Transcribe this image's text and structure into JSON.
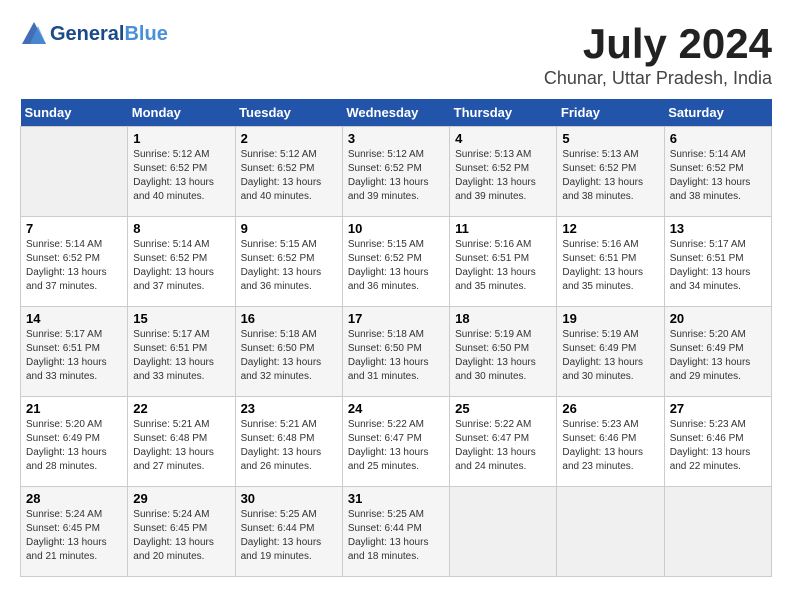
{
  "header": {
    "logo_line1": "General",
    "logo_line2": "Blue",
    "month_year": "July 2024",
    "location": "Chunar, Uttar Pradesh, India"
  },
  "weekdays": [
    "Sunday",
    "Monday",
    "Tuesday",
    "Wednesday",
    "Thursday",
    "Friday",
    "Saturday"
  ],
  "weeks": [
    [
      {
        "day": "",
        "sunrise": "",
        "sunset": "",
        "daylight": ""
      },
      {
        "day": "1",
        "sunrise": "Sunrise: 5:12 AM",
        "sunset": "Sunset: 6:52 PM",
        "daylight": "Daylight: 13 hours and 40 minutes."
      },
      {
        "day": "2",
        "sunrise": "Sunrise: 5:12 AM",
        "sunset": "Sunset: 6:52 PM",
        "daylight": "Daylight: 13 hours and 40 minutes."
      },
      {
        "day": "3",
        "sunrise": "Sunrise: 5:12 AM",
        "sunset": "Sunset: 6:52 PM",
        "daylight": "Daylight: 13 hours and 39 minutes."
      },
      {
        "day": "4",
        "sunrise": "Sunrise: 5:13 AM",
        "sunset": "Sunset: 6:52 PM",
        "daylight": "Daylight: 13 hours and 39 minutes."
      },
      {
        "day": "5",
        "sunrise": "Sunrise: 5:13 AM",
        "sunset": "Sunset: 6:52 PM",
        "daylight": "Daylight: 13 hours and 38 minutes."
      },
      {
        "day": "6",
        "sunrise": "Sunrise: 5:14 AM",
        "sunset": "Sunset: 6:52 PM",
        "daylight": "Daylight: 13 hours and 38 minutes."
      }
    ],
    [
      {
        "day": "7",
        "sunrise": "Sunrise: 5:14 AM",
        "sunset": "Sunset: 6:52 PM",
        "daylight": "Daylight: 13 hours and 37 minutes."
      },
      {
        "day": "8",
        "sunrise": "Sunrise: 5:14 AM",
        "sunset": "Sunset: 6:52 PM",
        "daylight": "Daylight: 13 hours and 37 minutes."
      },
      {
        "day": "9",
        "sunrise": "Sunrise: 5:15 AM",
        "sunset": "Sunset: 6:52 PM",
        "daylight": "Daylight: 13 hours and 36 minutes."
      },
      {
        "day": "10",
        "sunrise": "Sunrise: 5:15 AM",
        "sunset": "Sunset: 6:52 PM",
        "daylight": "Daylight: 13 hours and 36 minutes."
      },
      {
        "day": "11",
        "sunrise": "Sunrise: 5:16 AM",
        "sunset": "Sunset: 6:51 PM",
        "daylight": "Daylight: 13 hours and 35 minutes."
      },
      {
        "day": "12",
        "sunrise": "Sunrise: 5:16 AM",
        "sunset": "Sunset: 6:51 PM",
        "daylight": "Daylight: 13 hours and 35 minutes."
      },
      {
        "day": "13",
        "sunrise": "Sunrise: 5:17 AM",
        "sunset": "Sunset: 6:51 PM",
        "daylight": "Daylight: 13 hours and 34 minutes."
      }
    ],
    [
      {
        "day": "14",
        "sunrise": "Sunrise: 5:17 AM",
        "sunset": "Sunset: 6:51 PM",
        "daylight": "Daylight: 13 hours and 33 minutes."
      },
      {
        "day": "15",
        "sunrise": "Sunrise: 5:17 AM",
        "sunset": "Sunset: 6:51 PM",
        "daylight": "Daylight: 13 hours and 33 minutes."
      },
      {
        "day": "16",
        "sunrise": "Sunrise: 5:18 AM",
        "sunset": "Sunset: 6:50 PM",
        "daylight": "Daylight: 13 hours and 32 minutes."
      },
      {
        "day": "17",
        "sunrise": "Sunrise: 5:18 AM",
        "sunset": "Sunset: 6:50 PM",
        "daylight": "Daylight: 13 hours and 31 minutes."
      },
      {
        "day": "18",
        "sunrise": "Sunrise: 5:19 AM",
        "sunset": "Sunset: 6:50 PM",
        "daylight": "Daylight: 13 hours and 30 minutes."
      },
      {
        "day": "19",
        "sunrise": "Sunrise: 5:19 AM",
        "sunset": "Sunset: 6:49 PM",
        "daylight": "Daylight: 13 hours and 30 minutes."
      },
      {
        "day": "20",
        "sunrise": "Sunrise: 5:20 AM",
        "sunset": "Sunset: 6:49 PM",
        "daylight": "Daylight: 13 hours and 29 minutes."
      }
    ],
    [
      {
        "day": "21",
        "sunrise": "Sunrise: 5:20 AM",
        "sunset": "Sunset: 6:49 PM",
        "daylight": "Daylight: 13 hours and 28 minutes."
      },
      {
        "day": "22",
        "sunrise": "Sunrise: 5:21 AM",
        "sunset": "Sunset: 6:48 PM",
        "daylight": "Daylight: 13 hours and 27 minutes."
      },
      {
        "day": "23",
        "sunrise": "Sunrise: 5:21 AM",
        "sunset": "Sunset: 6:48 PM",
        "daylight": "Daylight: 13 hours and 26 minutes."
      },
      {
        "day": "24",
        "sunrise": "Sunrise: 5:22 AM",
        "sunset": "Sunset: 6:47 PM",
        "daylight": "Daylight: 13 hours and 25 minutes."
      },
      {
        "day": "25",
        "sunrise": "Sunrise: 5:22 AM",
        "sunset": "Sunset: 6:47 PM",
        "daylight": "Daylight: 13 hours and 24 minutes."
      },
      {
        "day": "26",
        "sunrise": "Sunrise: 5:23 AM",
        "sunset": "Sunset: 6:46 PM",
        "daylight": "Daylight: 13 hours and 23 minutes."
      },
      {
        "day": "27",
        "sunrise": "Sunrise: 5:23 AM",
        "sunset": "Sunset: 6:46 PM",
        "daylight": "Daylight: 13 hours and 22 minutes."
      }
    ],
    [
      {
        "day": "28",
        "sunrise": "Sunrise: 5:24 AM",
        "sunset": "Sunset: 6:45 PM",
        "daylight": "Daylight: 13 hours and 21 minutes."
      },
      {
        "day": "29",
        "sunrise": "Sunrise: 5:24 AM",
        "sunset": "Sunset: 6:45 PM",
        "daylight": "Daylight: 13 hours and 20 minutes."
      },
      {
        "day": "30",
        "sunrise": "Sunrise: 5:25 AM",
        "sunset": "Sunset: 6:44 PM",
        "daylight": "Daylight: 13 hours and 19 minutes."
      },
      {
        "day": "31",
        "sunrise": "Sunrise: 5:25 AM",
        "sunset": "Sunset: 6:44 PM",
        "daylight": "Daylight: 13 hours and 18 minutes."
      },
      {
        "day": "",
        "sunrise": "",
        "sunset": "",
        "daylight": ""
      },
      {
        "day": "",
        "sunrise": "",
        "sunset": "",
        "daylight": ""
      },
      {
        "day": "",
        "sunrise": "",
        "sunset": "",
        "daylight": ""
      }
    ]
  ]
}
